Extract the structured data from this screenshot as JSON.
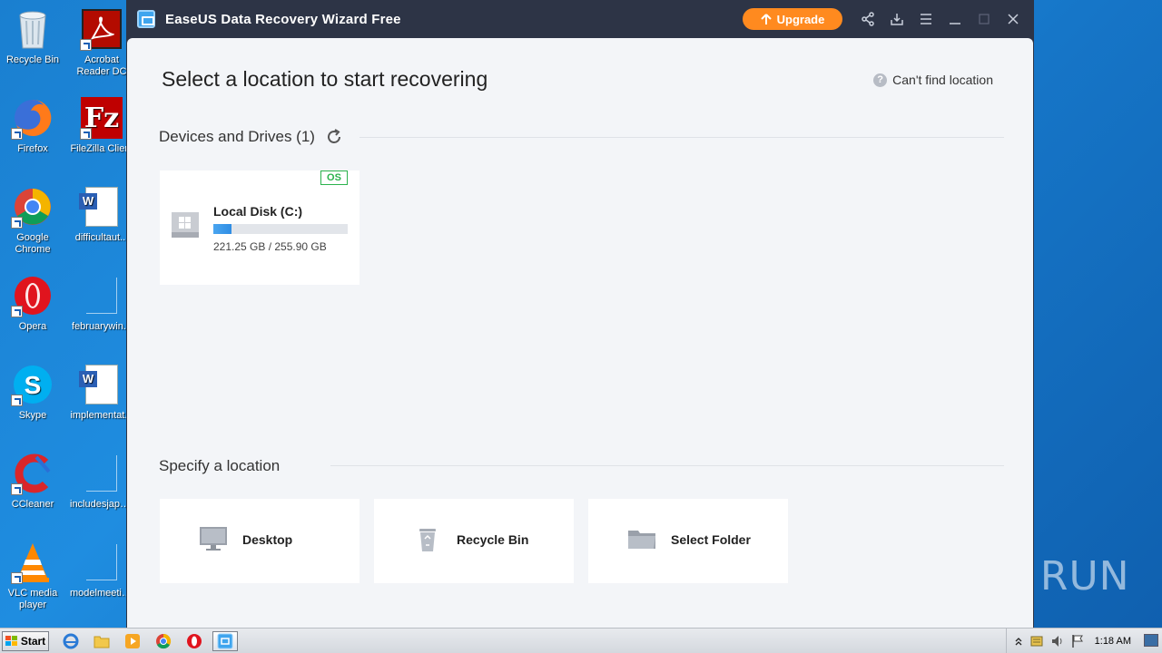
{
  "desktop": {
    "icons": [
      {
        "label": "Recycle Bin"
      },
      {
        "label": "Acrobat Reader DC"
      },
      {
        "label": "Firefox"
      },
      {
        "label": "FileZilla Client"
      },
      {
        "label": "Google Chrome"
      },
      {
        "label": "difficultaut..."
      },
      {
        "label": "Opera"
      },
      {
        "label": "februarywin..."
      },
      {
        "label": "Skype"
      },
      {
        "label": "implementat..."
      },
      {
        "label": "CCleaner"
      },
      {
        "label": "includesjapa..."
      },
      {
        "label": "VLC media player"
      },
      {
        "label": "modelmeetin..."
      }
    ],
    "watermark": "ANY RUN"
  },
  "window": {
    "title": "EaseUS Data Recovery Wizard Free",
    "upgrade_label": "Upgrade",
    "toolbar_icons": [
      "share-icon",
      "download-icon",
      "menu-icon",
      "minimize-icon",
      "maximize-icon",
      "close-icon"
    ]
  },
  "main": {
    "page_title": "Select a location to start recovering",
    "help_link": "Can't find location",
    "devices_section": "Devices and Drives (1)",
    "drives": [
      {
        "name": "Local Disk (C:)",
        "badge": "OS",
        "size_text": "221.25 GB / 255.90 GB",
        "used_fraction": 0.136
      }
    ],
    "specify_section": "Specify a location",
    "locations": [
      {
        "label": "Desktop",
        "icon": "monitor-icon"
      },
      {
        "label": "Recycle Bin",
        "icon": "recycle-bin-icon"
      },
      {
        "label": "Select Folder",
        "icon": "folder-icon"
      }
    ]
  },
  "taskbar": {
    "start_label": "Start",
    "clock": "1:18 AM"
  },
  "colors": {
    "accent_orange": "#ff8a1f",
    "title_bar": "#2d3446",
    "content_bg": "#f3f5f8",
    "os_badge": "#2bb24c",
    "progress_blue": "#2f8de4"
  }
}
